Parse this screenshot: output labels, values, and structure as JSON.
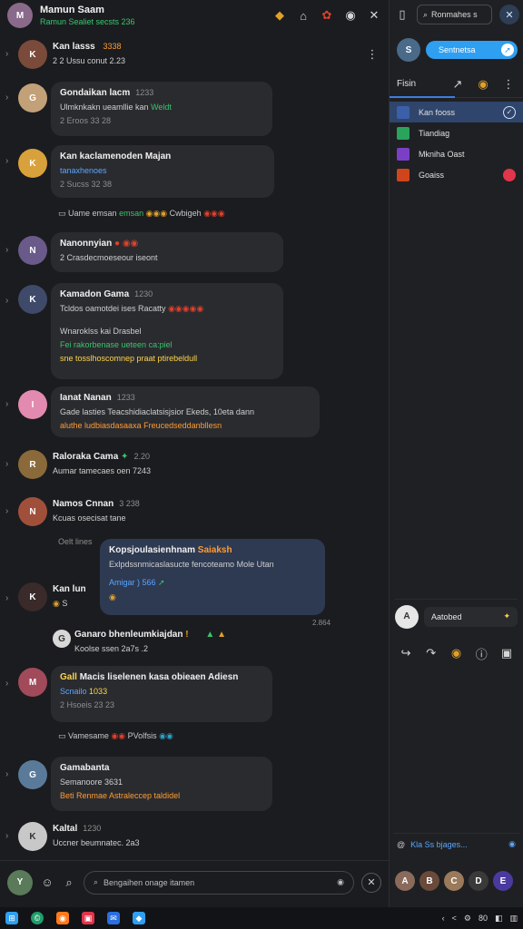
{
  "header": {
    "name": "Mamun Saam",
    "status": "Ramun Sealiet secsts 236"
  },
  "messages": [
    {
      "name": "Kan lasss",
      "time": "3338",
      "line1": "2 2  Ussu  conut  2.23"
    },
    {
      "name": "Gondaikan lacm",
      "time": "1233",
      "line1": "Ulmknkakn ueamllie kan",
      "line1b": "Weldt",
      "line2": "2 Eroos 33 28"
    },
    {
      "name": "Kan kaclamenoden Majan",
      "line1": "tanaxhenoes",
      "line2": "2 Sucss 32 38"
    },
    {
      "sys": "Uame emsan",
      "sys2": "Cwbigeh"
    },
    {
      "name": "Nanonnyian",
      "line1": "2  Crasdecmoeseour iseont"
    },
    {
      "name": "Kamadon Gama",
      "time": "1230",
      "line1": "Tcldos oamotdei ises Racatty",
      "line2": "Wnaroklss kai Drasbel",
      "line3": "Fei rakorbenase ueteen ca:piel",
      "line4": "sne  tosslhoscomnep praat  ptirebeldull"
    },
    {
      "name": "Ianat Nanan",
      "time": "1233",
      "line1": "Gade lasties  Teacshidiaclatsisjsior Ekeds, 10eta dann",
      "line2": "aluthe ludbiasdasaaxa Freucedseddanbllesn"
    },
    {
      "name": "Raloraka Cama",
      "time": "2.20",
      "line1": "Aumar tamecaes  oen 7243"
    },
    {
      "name": "Namos Cnnan",
      "time": "3 238",
      "line1": "Kcuas  osecisat  tane"
    },
    {
      "sys": "Oelt lines"
    },
    {
      "name": "Kopsjoulasienhnam",
      "tag": "Saiaksh",
      "line1": "Exlpdssnmicaslasucte fencoteamo Mole Utan",
      "line2": "Amigar  ) 566",
      "time": "2.864"
    },
    {
      "name": "Kan lun",
      "line1": "S"
    },
    {
      "name": "Ganaro   bhenleumkiajdan",
      "line1": "Koolse  ssen  2a7s .2"
    },
    {
      "name": "Macis liselenen kasa obieaen Adiesn",
      "prefix": "Gall",
      "line1": "Scnailo",
      "line1b": "1033",
      "line2": "2  Hsoeis 23 23"
    },
    {
      "sys": "Vamesame",
      "sys2": "PVolfsis"
    },
    {
      "name": "Gamabanta",
      "line1": "Semanoore  3631",
      "line2": "Beti  Renmae  Astraleccep  taldidel"
    },
    {
      "name": "Kaltal",
      "time": "1230",
      "line1": "Uccner beumnatec. 2a3"
    }
  ],
  "input": {
    "placeholder": "Bengaihen onage itamen"
  },
  "right_panel": {
    "search": "Ronmahes s",
    "user_pill": "Sentnetsa",
    "tab_label": "Fisin",
    "items": [
      {
        "label": "Kan fooss",
        "color": "#3b5fa8"
      },
      {
        "label": "Tiandiag",
        "color": "#2aa35c"
      },
      {
        "label": "Mkniha Oast",
        "color": "#7b3fc6"
      },
      {
        "label": "Goaiss",
        "color": "#d0451b"
      }
    ],
    "bottom_user": "Aatobed",
    "input_text": "Kla Ss bjages..."
  },
  "taskbar": {
    "clock": "80"
  },
  "colors": {
    "accent": "#2f9ff2",
    "online": "#37c871",
    "bubble": "#2a2b2f",
    "bubble_blue": "#2e3a52"
  }
}
